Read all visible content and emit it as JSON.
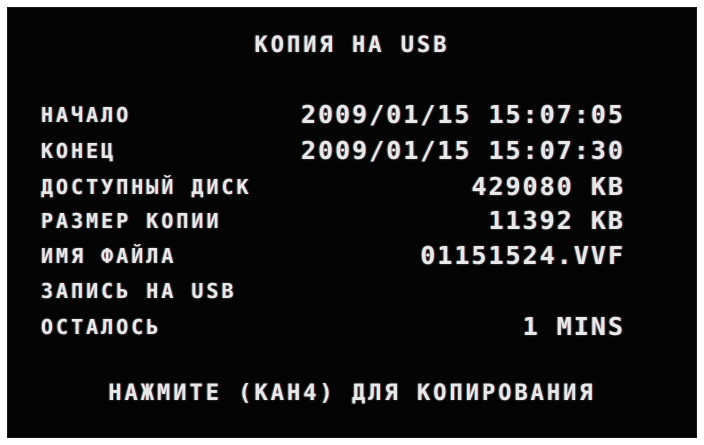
{
  "screen": {
    "title": "КОПИЯ НА USB",
    "rows": [
      {
        "label": "НАЧАЛО",
        "value": "2009/01/15 15:07:05"
      },
      {
        "label": "КОНЕЦ",
        "value": "2009/01/15 15:07:30"
      },
      {
        "label": "ДОСТУПНЫЙ ДИСК",
        "value": "429080 KB"
      },
      {
        "label": "РАЗМЕР КОПИИ",
        "value": "11392 KB"
      },
      {
        "label": "ИМЯ ФАЙЛА",
        "value": "01151524.VVF"
      },
      {
        "label": "ЗАПИСЬ НА USB",
        "value": ""
      },
      {
        "label": "ОСТАЛОСЬ",
        "value": "1 MINS"
      }
    ],
    "footer": "НАЖМИТЕ (КАН4) ДЛЯ КОПИРОВАНИЯ"
  }
}
